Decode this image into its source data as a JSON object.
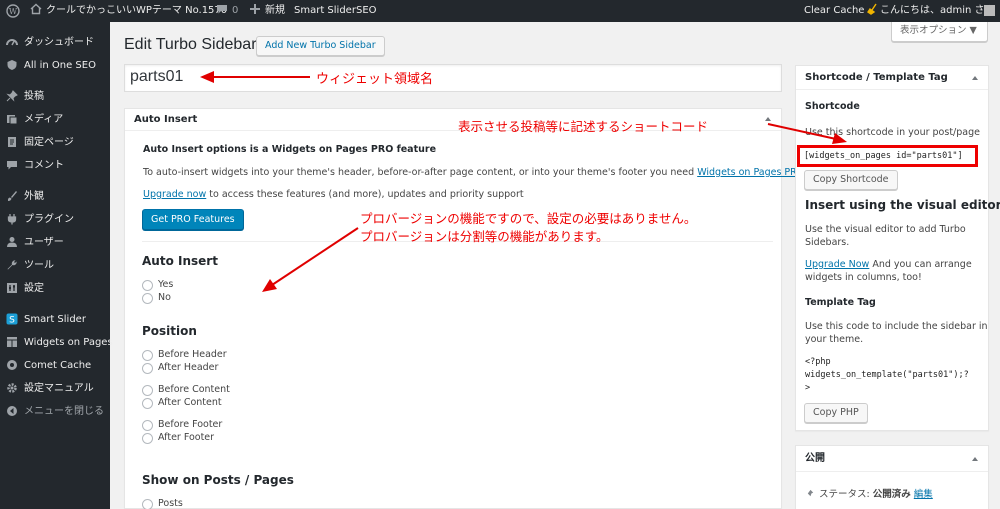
{
  "admin_bar": {
    "site_name": "クールでかっこいいWPテーマ No.1570",
    "comments_count": "0",
    "new_label": "新規",
    "smart_slider": "Smart Slider",
    "seo": "SEO",
    "clear_cache": "Clear Cache",
    "greeting": "こんにちは、admin さん"
  },
  "sidebar": {
    "items": [
      {
        "label": "ダッシュボード",
        "icon": "dashboard-icon"
      },
      {
        "label": "All in One SEO",
        "icon": "shield-icon"
      },
      {
        "label": "投稿",
        "icon": "pin-icon"
      },
      {
        "label": "メディア",
        "icon": "media-icon"
      },
      {
        "label": "固定ページ",
        "icon": "page-icon"
      },
      {
        "label": "コメント",
        "icon": "comment-icon"
      },
      {
        "label": "外観",
        "icon": "brush-icon"
      },
      {
        "label": "プラグイン",
        "icon": "plugin-icon"
      },
      {
        "label": "ユーザー",
        "icon": "user-icon"
      },
      {
        "label": "ツール",
        "icon": "wrench-icon"
      },
      {
        "label": "設定",
        "icon": "settings-icon"
      },
      {
        "label": "Smart Slider",
        "icon": "slider-icon"
      },
      {
        "label": "Widgets on Pages",
        "icon": "widgets-icon"
      },
      {
        "label": "Comet Cache",
        "icon": "cache-icon"
      },
      {
        "label": "設定マニュアル",
        "icon": "gear-icon"
      },
      {
        "label": "メニューを閉じる",
        "icon": "collapse-icon"
      }
    ]
  },
  "screen_options": "表示オプション ▼",
  "page": {
    "title": "Edit Turbo Sidebar",
    "add_new": "Add New Turbo Sidebar",
    "title_value": "parts01"
  },
  "auto_insert": {
    "header": "Auto Insert",
    "pro_notice": "Auto Insert options is a Widgets on Pages PRO feature",
    "desc_prefix": "To auto-insert widgets into your theme's header, before-or-after page content, or into your theme's footer you need",
    "desc_link": "Widgets on Pages PRO.",
    "upgrade_link": "Upgrade now",
    "upgrade_rest": "to access these features (and more), updates and priority support",
    "get_pro_button": "Get PRO Features",
    "section_title": "Auto Insert",
    "yes": "Yes",
    "no": "No",
    "position_title": "Position",
    "before_header": "Before Header",
    "after_header": "After Header",
    "before_content": "Before Content",
    "after_content": "After Content",
    "before_footer": "Before Footer",
    "after_footer": "After Footer",
    "show_on_title": "Show on Posts / Pages",
    "posts": "Posts"
  },
  "shortcode_box": {
    "header": "Shortcode / Template Tag",
    "shortcode_title": "Shortcode",
    "shortcode_desc": "Use this shortcode in your post/page",
    "shortcode_value": "[widgets_on_pages id=\"parts01\"]",
    "copy_shortcode": "Copy Shortcode",
    "visual_title": "Insert using the visual editor",
    "visual_desc1": "Use the visual editor to add Turbo",
    "visual_desc2": "Sidebars.",
    "upgrade_link": "Upgrade Now",
    "upgrade_rest1": " And you can arrange",
    "upgrade_rest2": "widgets in columns, too!",
    "template_title": "Template Tag",
    "template_desc1": "Use this code to include the sidebar in",
    "template_desc2": "your theme.",
    "code1": "<?php",
    "code2": "widgets_on_template(\"parts01\");?",
    "code3": ">",
    "copy_php": "Copy PHP"
  },
  "publish_box": {
    "header": "公開",
    "status_label": "ステータス: ",
    "status_value": "公開済み",
    "edit_link": "編集"
  },
  "annotations": {
    "widget_area_name": "ウィジェット領域名",
    "shortcode_note": "表示させる投稿等に記述するショートコード",
    "pro_note1": "プロバージョンの機能ですので、設定の必要はありません。",
    "pro_note2": "プロバージョンは分割等の機能があります。",
    "color": "#e00000"
  }
}
